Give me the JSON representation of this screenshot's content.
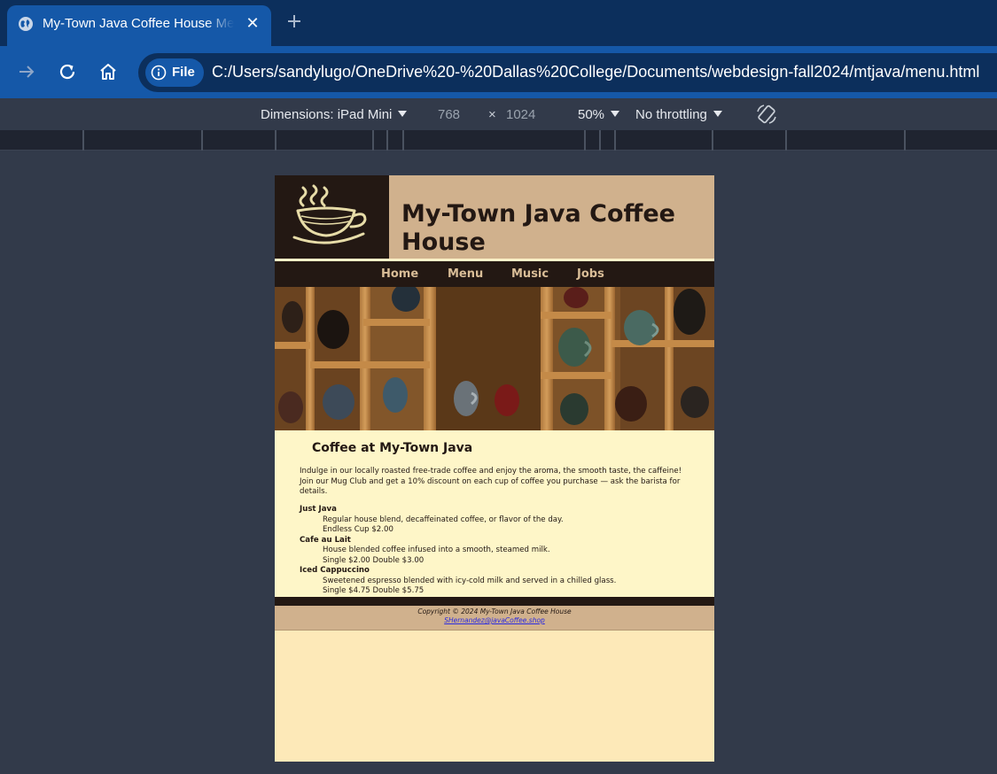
{
  "browser": {
    "tab": {
      "title": "My-Town Java Coffee House Menu",
      "close_glyph": "✕"
    },
    "omnibox": {
      "chip_label": "File",
      "url": "C:/Users/sandylugo/OneDrive%20-%20Dallas%20College/Documents/webdesign-fall2024/mtjava/menu.html"
    },
    "icons": [
      "globe-icon",
      "plus-icon",
      "forward-arrow-icon",
      "reload-icon",
      "home-icon",
      "info-icon",
      "rotate-icon"
    ]
  },
  "device_toolbar": {
    "dimensions_label": "Dimensions: iPad Mini",
    "width": "768",
    "times": "×",
    "height": "1024",
    "zoom": "50%",
    "throttling": "No throttling"
  },
  "page": {
    "site_title": "My-Town Java Coffee House",
    "nav": [
      "Home",
      "Menu",
      "Music",
      "Jobs"
    ],
    "heading": "Coffee at My-Town Java",
    "intro": "Indulge in our locally roasted free-trade coffee and enjoy the aroma, the smooth taste, the caffeine! Join our Mug Club and get a 10% discount on each cup of coffee you purchase — ask the barista for details.",
    "menu": [
      {
        "name": "Just Java",
        "description": "Regular house blend, decaffeinated coffee, or flavor of the day.",
        "price": "Endless Cup $2.00"
      },
      {
        "name": "Cafe au Lait",
        "description": "House blended coffee infused into a smooth, steamed milk.",
        "price": "Single $2.00 Double $3.00"
      },
      {
        "name": "Iced Cappuccino",
        "description": "Sweetened espresso blended with icy-cold milk and served in a chilled glass.",
        "price": "Single $4.75 Double $5.75"
      }
    ],
    "footer": {
      "copyright": "Copyright © 2024 My-Town Java Coffee House",
      "email": "SHernandez@javaCoffee.shop"
    }
  },
  "colors": {
    "dark_brown": "#231813",
    "tan": "#d0b18d",
    "cream": "#fef6c8",
    "page_bg": "#fde9b8",
    "nav_text": "#d9bd97"
  }
}
